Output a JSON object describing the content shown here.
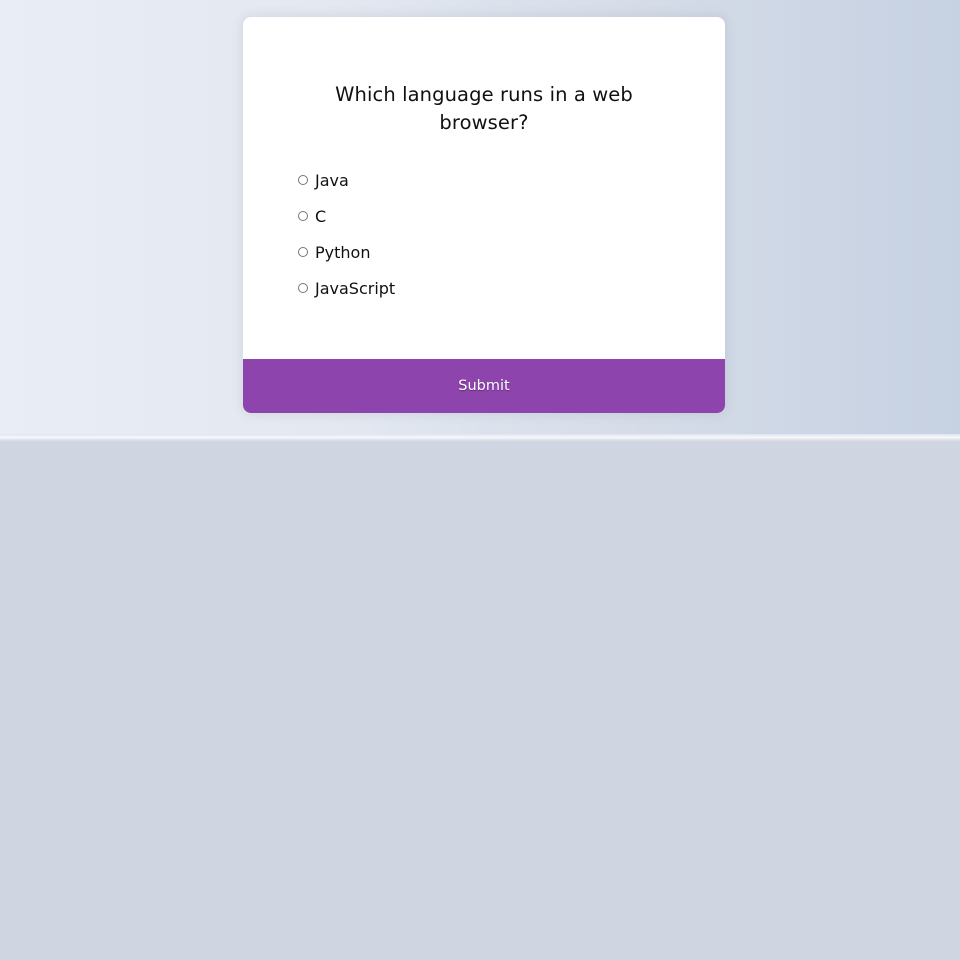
{
  "quiz": {
    "question": "Which language runs in a web browser?",
    "answers": [
      {
        "label": "Java"
      },
      {
        "label": "C"
      },
      {
        "label": "Python"
      },
      {
        "label": "JavaScript"
      }
    ],
    "submit_label": "Submit"
  },
  "colors": {
    "accent": "#8e44ad",
    "card": "#ffffff",
    "page_background": "#cfd5e1"
  }
}
